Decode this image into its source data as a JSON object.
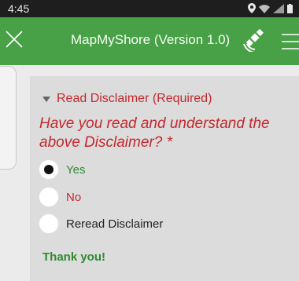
{
  "status": {
    "time": "4:45",
    "icons": [
      "location-icon",
      "wifi-icon",
      "signal-icon",
      "battery-icon"
    ]
  },
  "header": {
    "title": "MapMyShore (Version 1.0)",
    "background": "#48a047"
  },
  "form": {
    "section_title": "Read Disclaimer (Required)",
    "question": "Have you read and understand the above Disclaimer? *",
    "options": [
      {
        "label": "Yes",
        "selected": true,
        "color": "#2e8a2f"
      },
      {
        "label": "No",
        "selected": false,
        "color": "#c4282e"
      },
      {
        "label": "Reread Disclaimer",
        "selected": false,
        "color": "#222222"
      }
    ],
    "thanks": "Thank you!"
  }
}
